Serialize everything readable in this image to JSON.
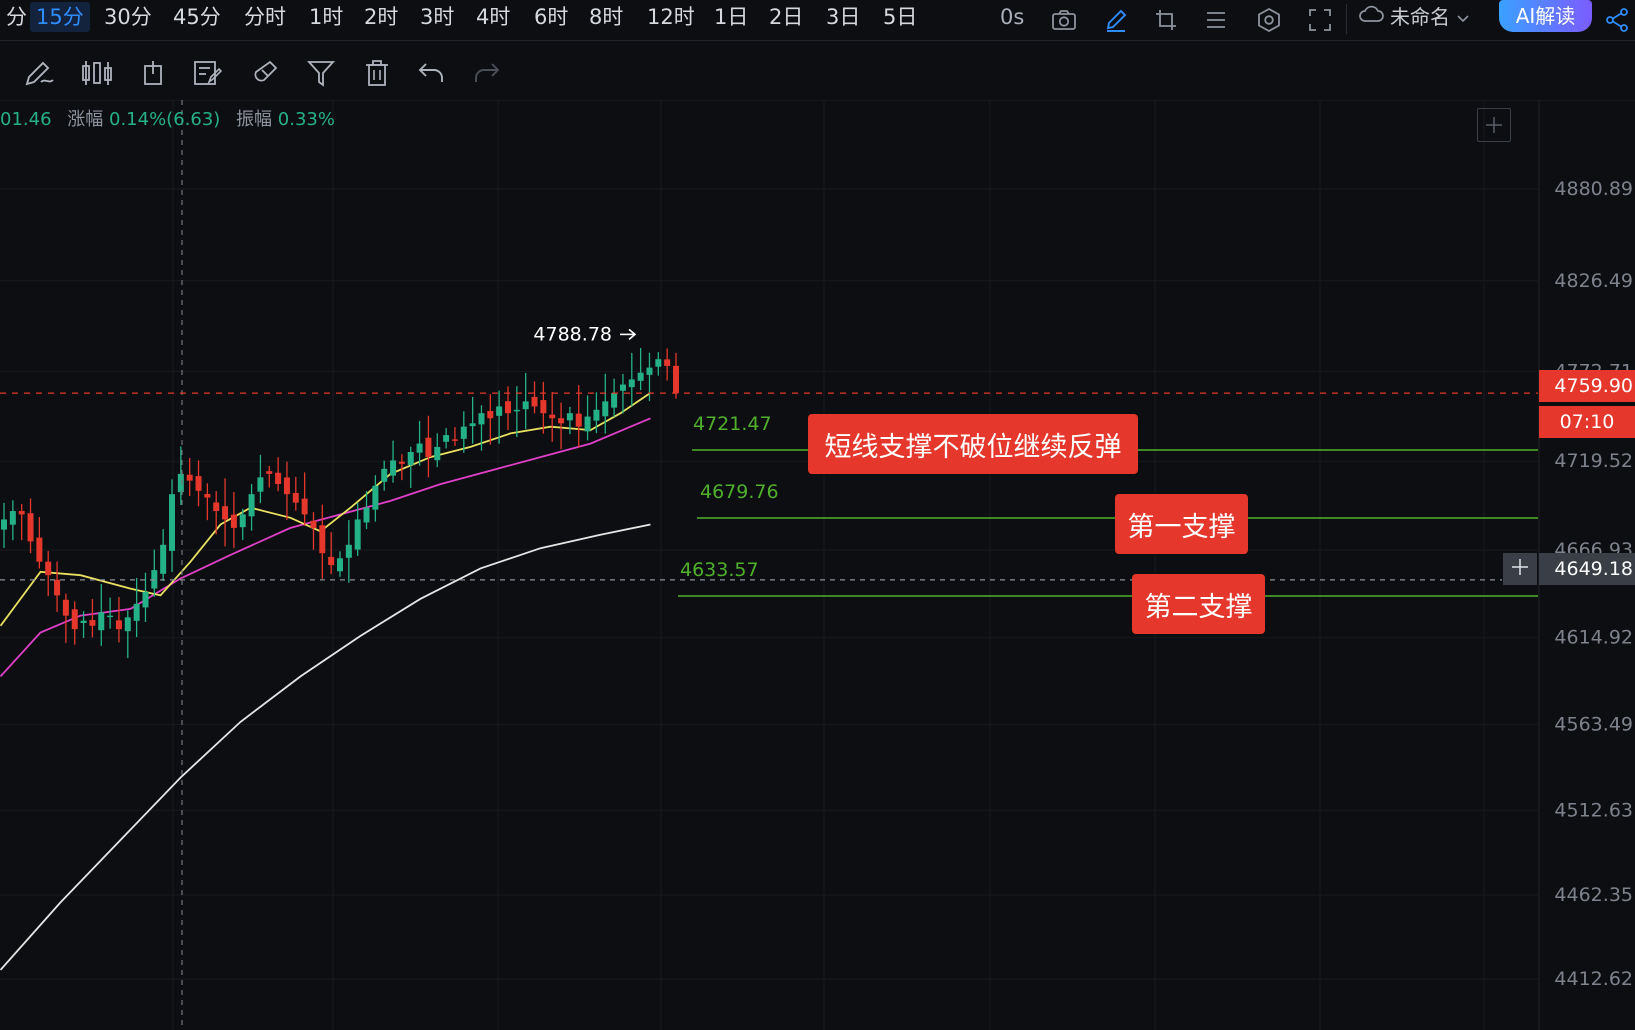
{
  "toolbar": {
    "intervals": [
      {
        "label": "分",
        "active": false
      },
      {
        "label": "15分",
        "active": true
      },
      {
        "label": "30分",
        "active": false
      },
      {
        "label": "45分",
        "active": false
      },
      {
        "label": "分时",
        "active": false
      },
      {
        "label": "1时",
        "active": false
      },
      {
        "label": "2时",
        "active": false
      },
      {
        "label": "3时",
        "active": false
      },
      {
        "label": "4时",
        "active": false
      },
      {
        "label": "6时",
        "active": false
      },
      {
        "label": "8时",
        "active": false
      },
      {
        "label": "12时",
        "active": false
      },
      {
        "label": "1日",
        "active": false
      },
      {
        "label": "2日",
        "active": false
      },
      {
        "label": "3日",
        "active": false
      },
      {
        "label": "5日",
        "active": false
      }
    ],
    "refresh": "0s",
    "project_name": "未命名",
    "ai_label": "AI解读",
    "icons": [
      "camera-icon",
      "pencil-icon",
      "crop-icon",
      "list-icon",
      "settings-icon",
      "fullscreen-icon",
      "cloud-icon",
      "chevron-down-icon",
      "share-icon"
    ]
  },
  "drawing_tools": [
    "brush-icon",
    "candlestick-icon",
    "indicator-icon",
    "note-icon",
    "magnet-icon",
    "filter-icon",
    "trash-icon",
    "undo-icon",
    "redo-icon"
  ],
  "infobar": {
    "price_frag": "01.46",
    "change_label": "涨幅",
    "change_value": "0.14%(6.63)",
    "amplitude_label": "振幅",
    "amplitude_value": "0.33%"
  },
  "price_axis": {
    "ticks": [
      "4880.89",
      "4826.49",
      "4772.71",
      "4719.52",
      "4666.93",
      "4614.92",
      "4563.49",
      "4512.63",
      "4462.35",
      "4412.62"
    ],
    "current_price": "4759.90",
    "countdown": "07:10",
    "crosshair_price": "4649.18"
  },
  "annotations": {
    "high_label": "4788.78",
    "level_1": "4721.47",
    "level_2": "4679.76",
    "level_3": "4633.57",
    "box_1": "短线支撑不破位继续反弹",
    "box_2": "第一支撑",
    "box_3": "第二支撑"
  },
  "colors": {
    "up": "#25b187",
    "down": "#e5372b",
    "ma_fast": "#e8e060",
    "ma_mid": "#e040c8",
    "ma_slow": "#e6e6e6",
    "support_line": "#4fb02c",
    "accent": "#2f8cff"
  },
  "chart_data": {
    "type": "candlestick",
    "timeframe": "15分",
    "y_axis_ticks": [
      4880.89,
      4826.49,
      4772.71,
      4719.52,
      4666.93,
      4614.92,
      4563.49,
      4512.63,
      4462.35,
      4412.62
    ],
    "current_price": 4759.9,
    "high_marker": 4788.78,
    "support_levels": [
      4721.47,
      4679.76,
      4633.57
    ],
    "crosshair_price": 4649.18,
    "close_path": [
      4685,
      4690,
      4688,
      4672,
      4660,
      4652,
      4640,
      4628,
      4620,
      4625,
      4622,
      4630,
      4628,
      4620,
      4627,
      4635,
      4642,
      4655,
      4670,
      4700,
      4712,
      4708,
      4702,
      4698,
      4690,
      4685,
      4680,
      4688,
      4700,
      4710,
      4712,
      4706,
      4700,
      4695,
      4688,
      4680,
      4665,
      4658,
      4662,
      4670,
      4685,
      4692,
      4705,
      4715,
      4720,
      4718,
      4725,
      4730,
      4722,
      4728,
      4735,
      4732,
      4740,
      4742,
      4748,
      4745,
      4752,
      4748,
      4750,
      4755,
      4752,
      4748,
      4745,
      4742,
      4748,
      4740,
      4746,
      4750,
      4755,
      4760,
      4765,
      4768,
      4772,
      4775,
      4780,
      4776,
      4760
    ],
    "ma_fast": [
      [
        0,
        4622
      ],
      [
        40,
        4654
      ],
      [
        80,
        4652
      ],
      [
        130,
        4644
      ],
      [
        160,
        4640
      ],
      [
        190,
        4660
      ],
      [
        220,
        4682
      ],
      [
        250,
        4692
      ],
      [
        290,
        4686
      ],
      [
        320,
        4678
      ],
      [
        350,
        4692
      ],
      [
        390,
        4712
      ],
      [
        430,
        4722
      ],
      [
        470,
        4728
      ],
      [
        510,
        4736
      ],
      [
        550,
        4740
      ],
      [
        590,
        4738
      ],
      [
        620,
        4748
      ],
      [
        650,
        4760
      ]
    ],
    "ma_mid": [
      [
        0,
        4592
      ],
      [
        40,
        4618
      ],
      [
        80,
        4628
      ],
      [
        130,
        4632
      ],
      [
        180,
        4650
      ],
      [
        230,
        4664
      ],
      [
        290,
        4680
      ],
      [
        340,
        4688
      ],
      [
        390,
        4696
      ],
      [
        440,
        4706
      ],
      [
        490,
        4714
      ],
      [
        540,
        4722
      ],
      [
        590,
        4730
      ],
      [
        630,
        4740
      ],
      [
        650,
        4745
      ]
    ],
    "ma_slow": [
      [
        0,
        4418
      ],
      [
        60,
        4458
      ],
      [
        120,
        4495
      ],
      [
        180,
        4532
      ],
      [
        240,
        4565
      ],
      [
        300,
        4592
      ],
      [
        360,
        4616
      ],
      [
        420,
        4638
      ],
      [
        480,
        4656
      ],
      [
        540,
        4668
      ],
      [
        600,
        4676
      ],
      [
        650,
        4682
      ]
    ]
  }
}
